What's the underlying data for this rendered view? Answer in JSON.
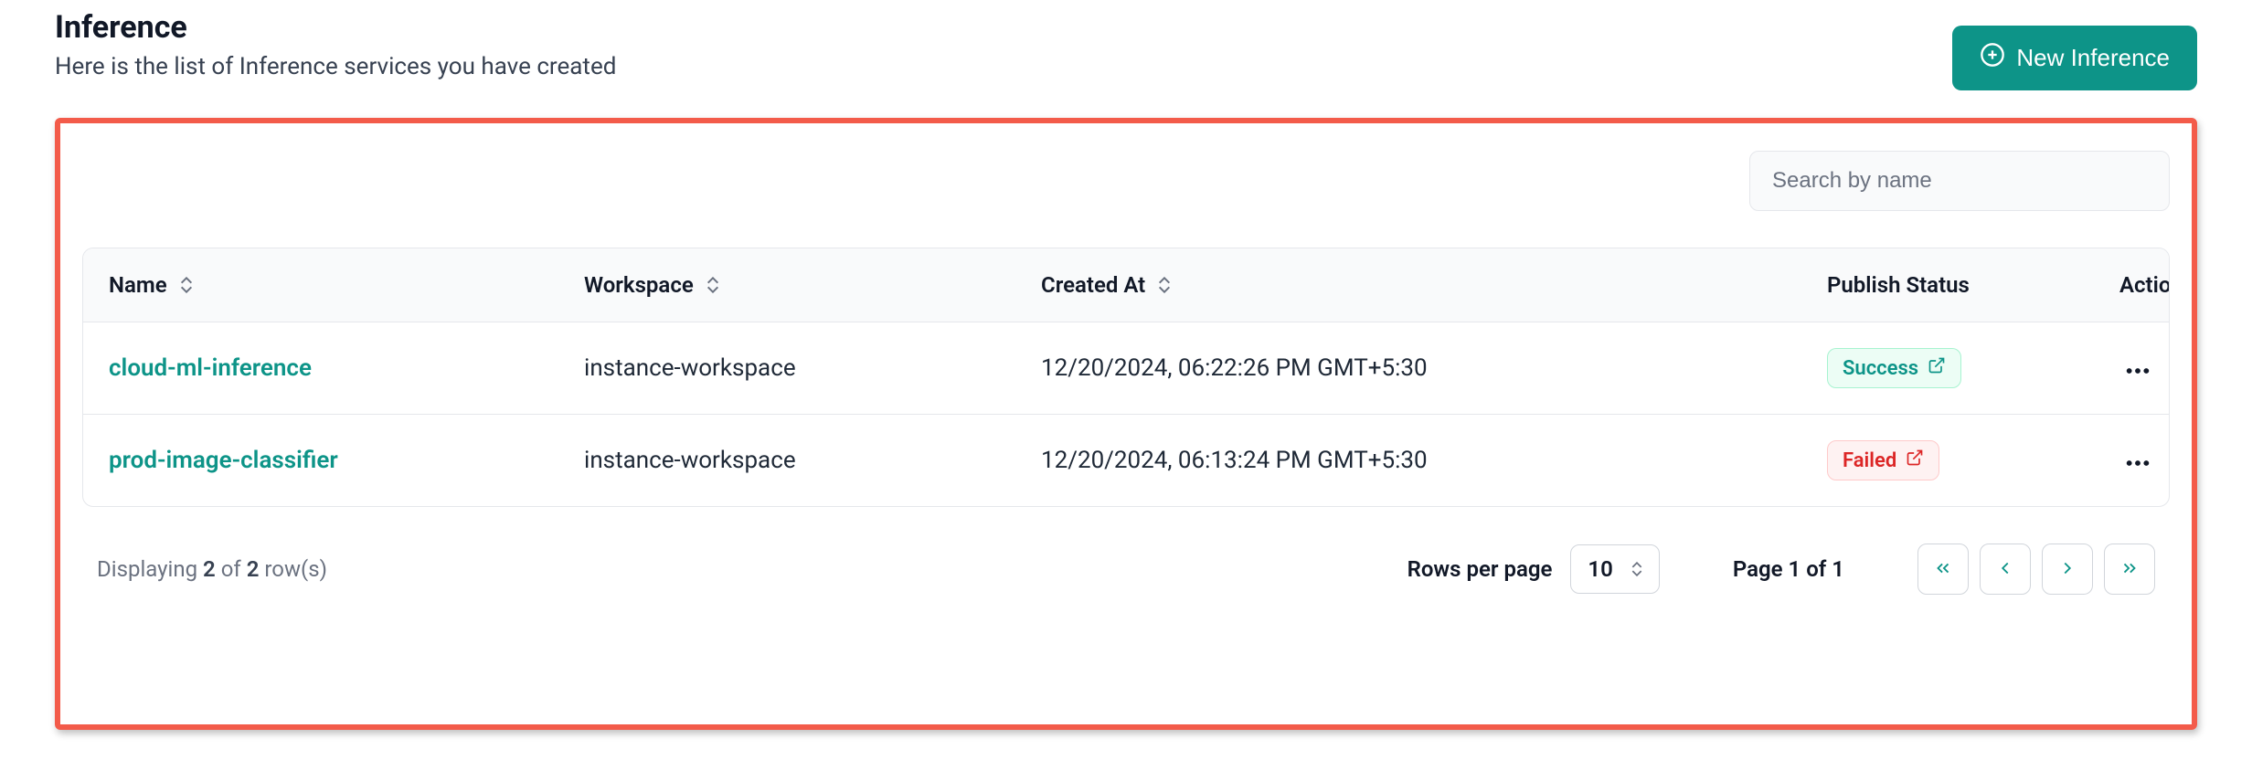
{
  "header": {
    "title": "Inference",
    "subtitle": "Here is the list of Inference services you have created",
    "new_button": "New Inference"
  },
  "search": {
    "placeholder": "Search by name"
  },
  "table": {
    "columns": {
      "name": "Name",
      "workspace": "Workspace",
      "created": "Created At",
      "status": "Publish Status",
      "actions": "Actions"
    },
    "rows": [
      {
        "name": "cloud-ml-inference",
        "workspace": "instance-workspace",
        "created": "12/20/2024, 06:22:26 PM GMT+5:30",
        "status_text": "Success",
        "status_kind": "success"
      },
      {
        "name": "prod-image-classifier",
        "workspace": "instance-workspace",
        "created": "12/20/2024, 06:13:24 PM GMT+5:30",
        "status_text": "Failed",
        "status_kind": "failed"
      }
    ]
  },
  "footer": {
    "displaying_prefix": "Displaying ",
    "count_shown": "2",
    "of_word": " of ",
    "count_total": "2",
    "rows_suffix": " row(s)",
    "rows_per_page_label": "Rows per page",
    "rows_per_page_value": "10",
    "page_info": "Page 1 of 1"
  }
}
